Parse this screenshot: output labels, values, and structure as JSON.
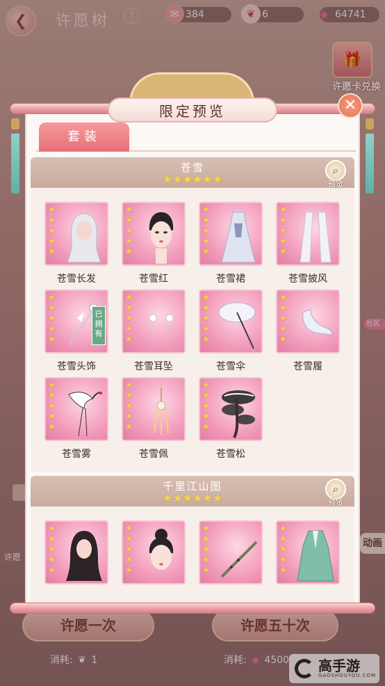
{
  "header": {
    "title": "许愿树",
    "help_icon": "?"
  },
  "currencies": [
    {
      "icon": "gift-ticket-icon",
      "value": "384"
    },
    {
      "icon": "gourd-icon",
      "value": "6"
    },
    {
      "icon": "diamond-icon",
      "value": "64741"
    }
  ],
  "exchange": {
    "label": "许愿卡兑换"
  },
  "side": {
    "left_text": "许愿",
    "community": "社区",
    "animation": "动画"
  },
  "modal": {
    "title": "限定预览",
    "close_icon": "close-icon",
    "tabs": [
      {
        "label": "套装",
        "active": true
      }
    ],
    "sets": [
      {
        "name": "苍雪",
        "stars": "★★★★★★",
        "preview_label": "预览",
        "items": [
          {
            "name": "苍雪长发",
            "art": "hair",
            "owned": false
          },
          {
            "name": "苍雪红",
            "art": "face",
            "owned": false
          },
          {
            "name": "苍雪裙",
            "art": "dress",
            "owned": false
          },
          {
            "name": "苍雪披风",
            "art": "cape",
            "owned": false
          },
          {
            "name": "苍雪头饰",
            "art": "hairpin",
            "owned": true
          },
          {
            "name": "苍雪耳坠",
            "art": "earrings",
            "owned": false
          },
          {
            "name": "苍雪伞",
            "art": "umbrella",
            "owned": false
          },
          {
            "name": "苍雪履",
            "art": "shoes",
            "owned": false
          },
          {
            "name": "苍雪雾",
            "art": "crane",
            "owned": false
          },
          {
            "name": "苍雪佩",
            "art": "pendant",
            "owned": false
          },
          {
            "name": "苍雪松",
            "art": "pine",
            "owned": false
          }
        ]
      },
      {
        "name": "千里江山图",
        "stars": "★★★★★★",
        "preview_label": "预览",
        "items": [
          {
            "name": "",
            "art": "hair-dark",
            "owned": false
          },
          {
            "name": "",
            "art": "face-bun",
            "owned": false
          },
          {
            "name": "",
            "art": "flute",
            "owned": false
          },
          {
            "name": "",
            "art": "robe-green",
            "owned": false
          }
        ]
      }
    ],
    "owned_tag": "已拥有",
    "item_stars": "★★★★★"
  },
  "bottom": {
    "wish_once": "许愿一次",
    "wish_fifty": "许愿五十次",
    "cost_label": "消耗:",
    "cost_once": "1",
    "cost_fifty": "45000"
  },
  "watermark": {
    "name": "高手游",
    "domain": "GAOSHOUYOU.COM"
  },
  "colors": {
    "accent": "#e86f77",
    "star": "#f8d54a",
    "card": "#f29bbb",
    "owned": "#6aa884"
  }
}
